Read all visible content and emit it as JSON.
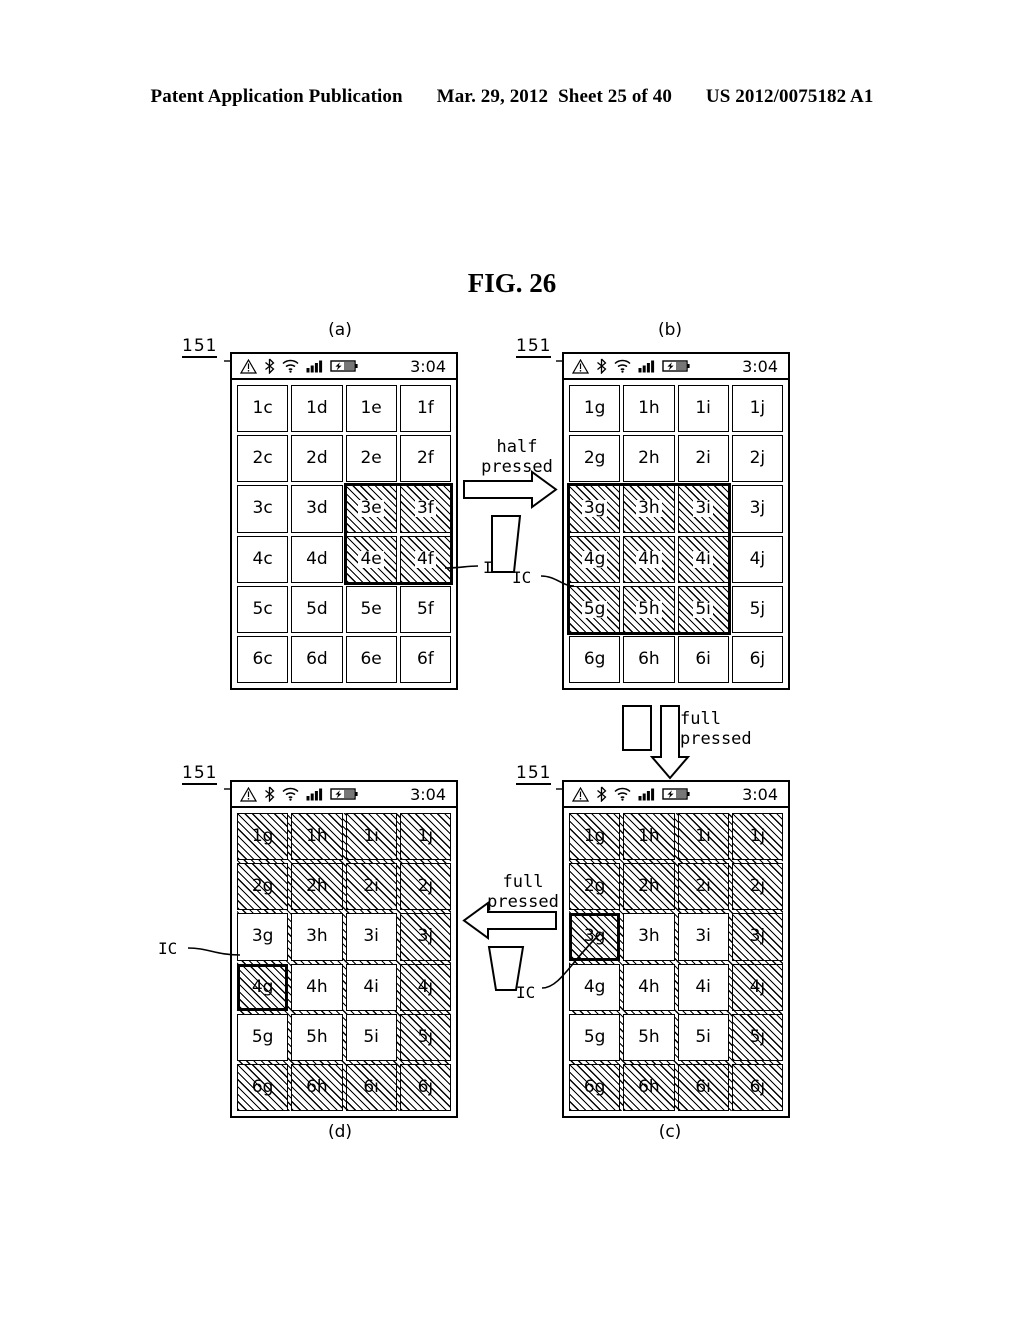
{
  "header": {
    "left": "Patent Application Publication",
    "date": "Mar. 29, 2012",
    "sheet": "Sheet 25 of 40",
    "patent_number": "US 2012/0075182 A1"
  },
  "figure": {
    "title": "FIG. 26",
    "reference_numeral": "151",
    "ic_label": "IC"
  },
  "statusbar": {
    "time": "3:04",
    "icons": [
      "warning-triangle-icon",
      "bluetooth-icon",
      "wifi-icon",
      "signal-bars-icon",
      "battery-charging-icon"
    ]
  },
  "flow": {
    "half_pressed": "half\npressed",
    "full_pressed": "full\npressed"
  },
  "panels": [
    {
      "id": "a",
      "letter": "(a)",
      "columns": [
        "c",
        "d",
        "e",
        "f"
      ],
      "rows": [
        "1",
        "2",
        "3",
        "4",
        "5",
        "6"
      ],
      "cells": [
        [
          "1c",
          "1d",
          "1e",
          "1f"
        ],
        [
          "2c",
          "2d",
          "2e",
          "2f"
        ],
        [
          "3c",
          "3d",
          "3e",
          "3f"
        ],
        [
          "4c",
          "4d",
          "4e",
          "4f"
        ],
        [
          "5c",
          "5d",
          "5e",
          "5f"
        ],
        [
          "6c",
          "6d",
          "6e",
          "6f"
        ]
      ],
      "background_hatched": false,
      "hatched_cells": [
        "3e",
        "3f",
        "4e",
        "4f"
      ],
      "selection_box": {
        "col_start": 3,
        "col_end": 4,
        "row_start": 3,
        "row_end": 4
      }
    },
    {
      "id": "b",
      "letter": "(b)",
      "columns": [
        "g",
        "h",
        "i",
        "j"
      ],
      "rows": [
        "1",
        "2",
        "3",
        "4",
        "5",
        "6"
      ],
      "cells": [
        [
          "1g",
          "1h",
          "1i",
          "1j"
        ],
        [
          "2g",
          "2h",
          "2i",
          "2j"
        ],
        [
          "3g",
          "3h",
          "3i",
          "3j"
        ],
        [
          "4g",
          "4h",
          "4i",
          "4j"
        ],
        [
          "5g",
          "5h",
          "5i",
          "5j"
        ],
        [
          "6g",
          "6h",
          "6i",
          "6j"
        ]
      ],
      "background_hatched": false,
      "hatched_cells": [
        "3g",
        "3h",
        "3i",
        "4g",
        "4h",
        "4i",
        "5g",
        "5h",
        "5i"
      ],
      "selection_box": {
        "col_start": 1,
        "col_end": 3,
        "row_start": 3,
        "row_end": 5
      }
    },
    {
      "id": "c",
      "letter": "(c)",
      "columns": [
        "g",
        "h",
        "i",
        "j"
      ],
      "rows": [
        "1",
        "2",
        "3",
        "4",
        "5",
        "6"
      ],
      "cells": [
        [
          "1g",
          "1h",
          "1i",
          "1j"
        ],
        [
          "2g",
          "2h",
          "2i",
          "2j"
        ],
        [
          "3g",
          "3h",
          "3i",
          "3j"
        ],
        [
          "4g",
          "4h",
          "4i",
          "4j"
        ],
        [
          "5g",
          "5h",
          "5i",
          "5j"
        ],
        [
          "6g",
          "6h",
          "6i",
          "6j"
        ]
      ],
      "background_hatched": true,
      "white_cells": [
        "3h",
        "3i",
        "4g",
        "4h",
        "4i",
        "5g",
        "5h",
        "5i"
      ],
      "selected_cell": "3g"
    },
    {
      "id": "d",
      "letter": "(d)",
      "columns": [
        "g",
        "h",
        "i",
        "j"
      ],
      "rows": [
        "1",
        "2",
        "3",
        "4",
        "5",
        "6"
      ],
      "cells": [
        [
          "1g",
          "1h",
          "1i",
          "1j"
        ],
        [
          "2g",
          "2h",
          "2i",
          "2j"
        ],
        [
          "3g",
          "3h",
          "3i",
          "3j"
        ],
        [
          "4g",
          "4h",
          "4i",
          "4j"
        ],
        [
          "5g",
          "5h",
          "5i",
          "5j"
        ],
        [
          "6g",
          "6h",
          "6i",
          "6j"
        ]
      ],
      "background_hatched": true,
      "white_cells": [
        "3g",
        "3h",
        "3i",
        "4h",
        "4i",
        "5g",
        "5h",
        "5i"
      ],
      "selected_cell": "4g"
    }
  ]
}
